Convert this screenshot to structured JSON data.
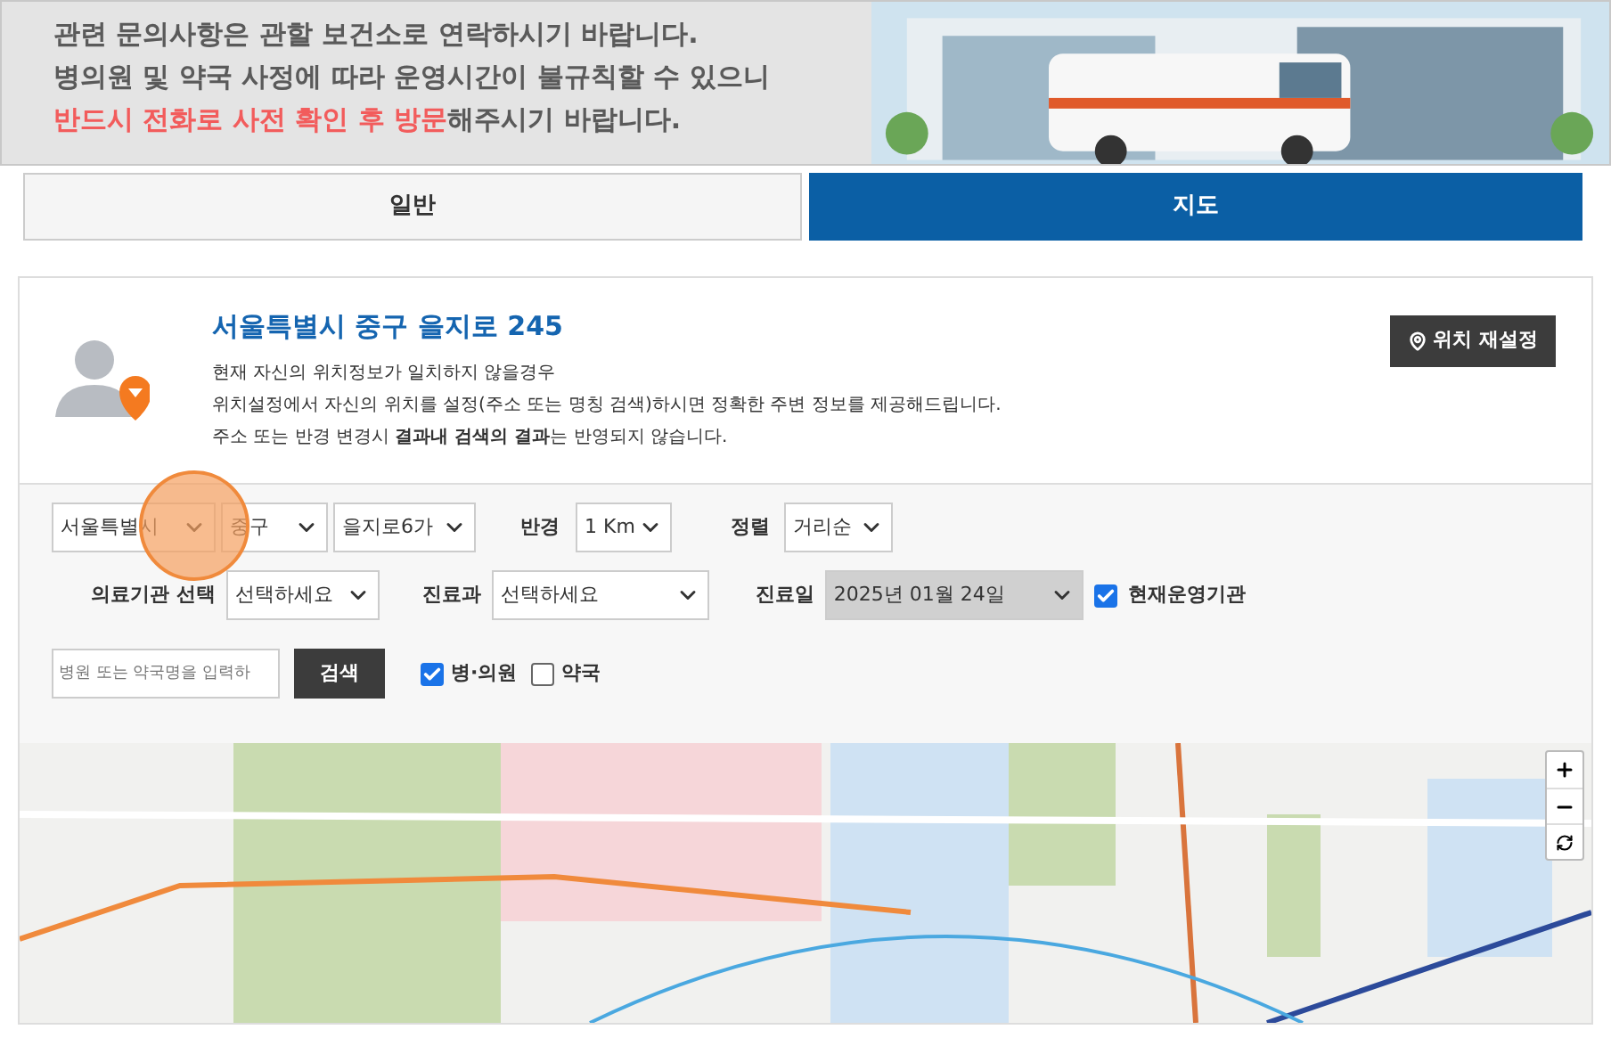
{
  "notice": {
    "lines": [
      "관련 문의사항은 관할 보건소로 연락하시기 바랍니다.",
      "병의원 및 약국 사정에 따라 운영시간이 불규칙할 수 있으니",
      "**반드시 전화로 사전 확인 후 방문**해주시기 바랍니다."
    ]
  },
  "tabs": [
    {
      "label": "일반",
      "selected": false
    },
    {
      "label": "지도",
      "selected": true
    }
  ],
  "location": {
    "address": "서울특별시 중구 을지로 245",
    "lines": [
      "현재 자신의 위치정보가 일치하지 않을경우",
      "위치설정에서 자신의 위치를 설정(주소 또는 명칭 검색)하시면 정확한 주변 정보를 제공해드립니다.",
      "주소 또는 반경 변경시 **결과내 검색의 결과**는 반영되지 않습니다."
    ],
    "reset_button": "위치 재설정"
  },
  "filters": {
    "city": "서울특별시",
    "district": "중구",
    "dong": "을지로6가",
    "radius_label": "반경",
    "radius": "1 Km",
    "sort_label": "정렬",
    "sort": "거리순",
    "institution_label": "의료기관 선택",
    "institution": "선택하세요",
    "department_label": "진료과",
    "department": "선택하세요",
    "date_label": "진료일",
    "date": "2025년 01월 24일",
    "open_now": {
      "label": "현재운영기관",
      "checked": true
    },
    "search_placeholder": "병원 또는 약국명을 입력하",
    "search_button": "검색",
    "types": [
      {
        "label": "병·의원",
        "checked": true
      },
      {
        "label": "약국",
        "checked": false
      }
    ]
  }
}
